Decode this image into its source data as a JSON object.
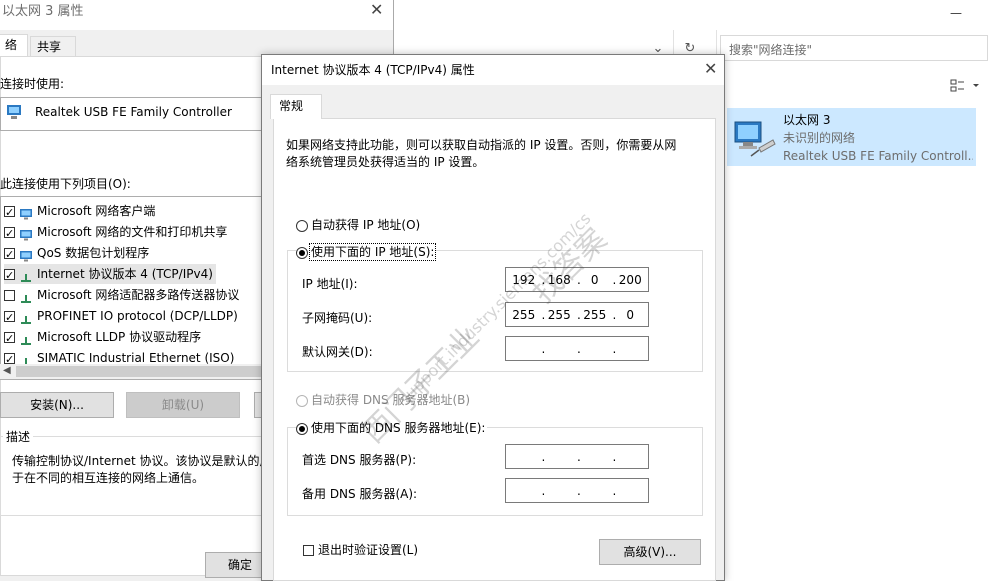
{
  "explorer": {
    "search_placeholder": "搜索\"网络连接\"",
    "dropdown_glyph": "⌄",
    "refresh_glyph": "↻",
    "connection": {
      "name": "以太网 3",
      "status": "未识别的网络",
      "adapter": "Realtek USB FE Family Controll..."
    }
  },
  "props_window": {
    "title": "以太网 3 属性",
    "tabs": [
      "络",
      "共享"
    ],
    "connect_using_label": "连接时使用:",
    "adapter_name": "Realtek USB FE Family Controller",
    "items_label": "此连接使用下列项目(O):",
    "items": [
      {
        "label": "Microsoft 网络客户端",
        "checked": true
      },
      {
        "label": "Microsoft 网络的文件和打印机共享",
        "checked": true
      },
      {
        "label": "QoS 数据包计划程序",
        "checked": true
      },
      {
        "label": "Internet 协议版本 4 (TCP/IPv4)",
        "checked": true
      },
      {
        "label": "Microsoft 网络适配器多路传送器协议",
        "checked": false
      },
      {
        "label": "PROFINET IO protocol (DCP/LLDP)",
        "checked": true
      },
      {
        "label": "Microsoft LLDP 协议驱动程序",
        "checked": true
      },
      {
        "label": "SIMATIC Industrial Ethernet (ISO)",
        "checked": true
      }
    ],
    "install_button": "安装(N)...",
    "uninstall_button": "卸载(U)",
    "description_label": "描述",
    "description_line1": "传输控制协议/Internet 协议。该协议是默认的广",
    "description_line2": "于在不同的相互连接的网络上通信。",
    "ok_button": "确定"
  },
  "dialog": {
    "title": "Internet 协议版本 4 (TCP/IPv4) 属性",
    "tab": "常规",
    "intro_line1": "如果网络支持此功能，则可以获取自动指派的 IP 设置。否则，你需要从网",
    "intro_line2": "络系统管理员处获得适当的 IP 设置。",
    "auto_ip": "自动获得 IP 地址(O)",
    "manual_ip": "使用下面的 IP 地址(S):",
    "ip_label": "IP 地址(I):",
    "ip_value": [
      "192",
      "168",
      "0",
      "200"
    ],
    "mask_label": "子网掩码(U):",
    "mask_value": [
      "255",
      "255",
      "255",
      "0"
    ],
    "gateway_label": "默认网关(D):",
    "auto_dns": "自动获得 DNS 服务器地址(B)",
    "manual_dns": "使用下面的 DNS 服务器地址(E):",
    "preferred_dns_label": "首选 DNS 服务器(P):",
    "alternate_dns_label": "备用 DNS 服务器(A):",
    "validate_label": "退出时验证设置(L)",
    "advanced_button": "高级(V)...",
    "dot": "."
  },
  "watermark": {
    "line1": "找答案",
    "line2": "support.industry.siemens.com/cs",
    "line3": "西门子工业"
  }
}
